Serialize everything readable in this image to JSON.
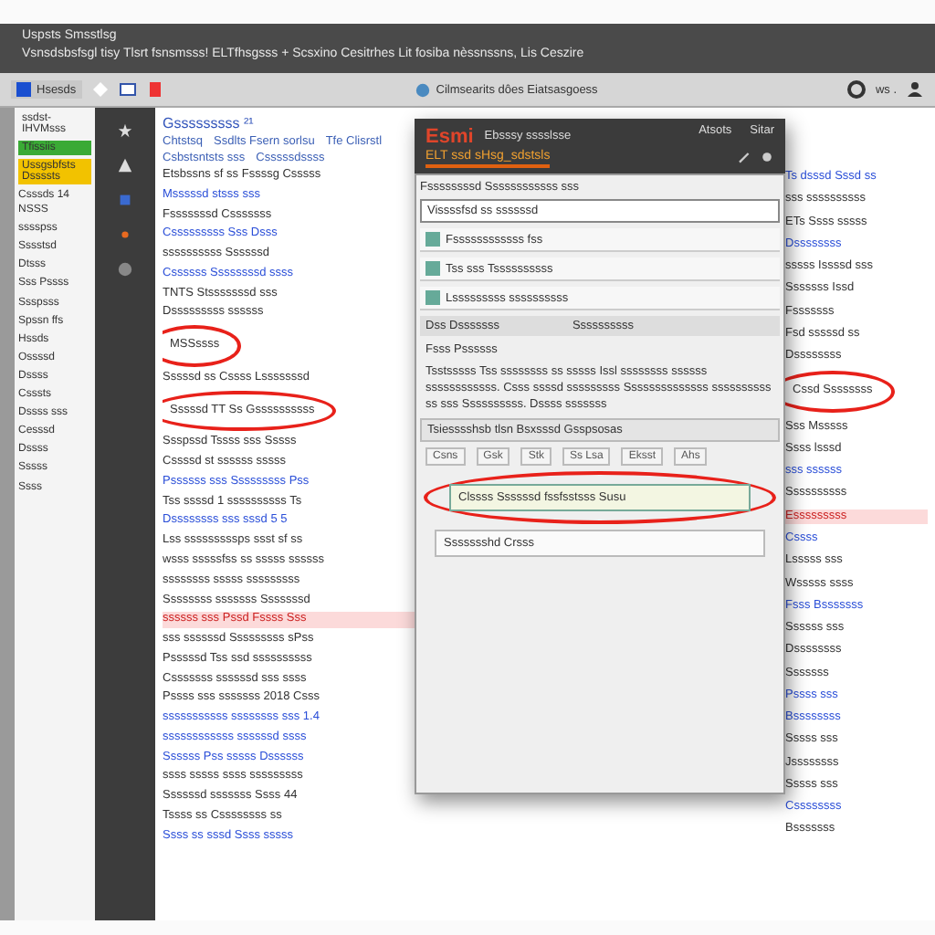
{
  "window": {
    "caption": "Uspsts Smsstlsg",
    "title": "Vsnsdsbsfsgl tisy Tlsrt fsnsmsss! ELTfhsgsss +  Scsxino Cesitrhes Lit fosiba nèssnssns, Lis Ceszire"
  },
  "toolbar": {
    "app_label": "Hsesds",
    "address": "Cilmsearits dôes Eiatsasgoess",
    "menu_label": "ws ."
  },
  "sidebar": {
    "header": "ssdst- IHVMsss",
    "items": [
      {
        "label": "Tfissiis",
        "color": "#3aaa35"
      },
      {
        "label": "Ussgsbfsts Dssssts",
        "color": "#f2c200"
      }
    ],
    "lines": [
      "Csssds 14 NSSS",
      "sssspss",
      "Sssstsd",
      "Dtsss",
      "Sss Pssss",
      "Ssspsss",
      "Spssn ffs",
      "Hssds",
      "Ossssd",
      "Dssss",
      "Csssts",
      "Dssss sss",
      "Cesssd",
      "Dssss",
      "Sssss",
      "Ssss"
    ]
  },
  "page": {
    "logo": "Gsssssssss ²¹",
    "nav": [
      "Chtstsq",
      "Ssdlts Fsern sorlsu",
      "Tfe Clisrstl"
    ],
    "subnav": [
      "Csbstsntsts sss",
      "Csssssdssss"
    ],
    "lines": [
      {
        "text": "Etsbssns sf ss Fssssg Csssss",
        "kind": "plain"
      },
      {
        "text": "Msssssd stsss sss",
        "kind": "link"
      },
      {
        "text": "Fsssssssd Csssssss",
        "kind": "plain"
      },
      {
        "text": "Csssssssss Sss Dsss",
        "kind": "link"
      },
      {
        "text": "ssssssssss Ssssssd",
        "kind": "plain"
      },
      {
        "text": "Cssssss Ssssssssd ssss",
        "kind": "link"
      },
      {
        "text": "TNTS Stsssssssd sss",
        "kind": "plain"
      },
      {
        "text": "Dsssssssss ssssss",
        "kind": "plain"
      },
      {
        "text": "MSSssss",
        "kind": "circled"
      },
      {
        "text": "Sssssd ss Cssss Lsssssssd",
        "kind": "plain"
      },
      {
        "text": "Sssssd TT Ss Gssssssssss",
        "kind": "circled"
      },
      {
        "text": "Ssspssd Tssss sss Sssss",
        "kind": "plain"
      },
      {
        "text": "Cssssd st ssssss sssss",
        "kind": "plain"
      },
      {
        "text": "Pssssss sss Sssssssss Pss",
        "kind": "link"
      },
      {
        "text": "Tss ssssd 1 ssssssssss Ts",
        "kind": "plain"
      },
      {
        "text": "Dssssssss sss sssd 5 5",
        "kind": "link"
      },
      {
        "text": "Lss sssssssssps ssst sf ss",
        "kind": "plain"
      },
      {
        "text": "wsss sssssfss ss sssss ssssss",
        "kind": "plain"
      },
      {
        "text": "ssssssss sssss sssssssss",
        "kind": "plain"
      },
      {
        "text": "Ssssssss sssssss Sssssssd",
        "kind": "plain"
      },
      {
        "text": "ssssss sss Pssd Fssss Sss",
        "kind": "highlight"
      },
      {
        "text": "sss ssssssd Sssssssss sPss",
        "kind": "plain"
      },
      {
        "text": "Psssssd Tss ssd ssssssssss",
        "kind": "plain"
      },
      {
        "text": "Csssssss ssssssd sss ssss",
        "kind": "plain"
      },
      {
        "text": "Pssss sss sssssss 2018 Csss",
        "kind": "plain"
      },
      {
        "text": "sssssssssss ssssssss sss 1.4",
        "kind": "link"
      },
      {
        "text": "ssssssssssss ssssssd ssss",
        "kind": "link"
      },
      {
        "text": "Ssssss Pss sssss Dssssss",
        "kind": "link"
      },
      {
        "text": "ssss sssss ssss sssssssss",
        "kind": "plain"
      },
      {
        "text": "Ssssssd sssssss Ssss 44",
        "kind": "plain"
      },
      {
        "text": "Tssss ss Cssssssss ss",
        "kind": "plain"
      },
      {
        "text": "Ssss ss sssd Ssss sssss",
        "kind": "link"
      }
    ]
  },
  "dialog": {
    "title": "Esmi",
    "subtitle": "Ebsssy sssslsse",
    "menu": [
      "Atsots",
      "Sitar"
    ],
    "tab": "ELT ssd sHsg_sdstsls",
    "header": "Fssssssssd Ssssssssssss sss",
    "field": "Vissssfsd ss ssssssd",
    "rows": [
      {
        "label": "Fssssssssssss fss",
        "selected": false
      },
      {
        "label": "Tss sss Tssssssssss",
        "selected": false
      },
      {
        "label": "Lsssssssss ssssssssss",
        "selected": false
      }
    ],
    "section": [
      "Dss Dsssssss",
      "Ssssssssss"
    ],
    "note": "Fsss Pssssss",
    "paragraph": "Tsstsssss Tss ssssssss ss sssss Issl ssssssss ssssss ssssssssssss. Csss ssssd sssssssss Ssssssssssssss ssssssssss ss sss Ssssssssss. Dssss sssssss",
    "bar": "Tsiesssshsb tlsn Bsxsssd Gsspsosas",
    "buttons": [
      "Csns",
      "Gsk",
      "Stk",
      "Ss Lsa",
      "Eksst",
      "Ahs"
    ],
    "items": [
      {
        "label": "Clssss Ssssssd fssfsstsss Susu",
        "selected": true,
        "circled": true
      },
      {
        "label": "Ssssssshd Crsss",
        "selected": false,
        "circled": false
      }
    ]
  },
  "right": {
    "lines": [
      {
        "text": "Ts dsssd Sssd ss",
        "kind": "link"
      },
      {
        "text": "sss ssssssssss",
        "kind": "plain"
      },
      {
        "text": "ETs Ssss sssss",
        "kind": "plain"
      },
      {
        "text": "Dssssssss",
        "kind": "link"
      },
      {
        "text": "sssss Issssd sss",
        "kind": "plain"
      },
      {
        "text": "Sssssss Issd",
        "kind": "plain"
      },
      {
        "text": "Fsssssss",
        "kind": "plain"
      },
      {
        "text": "Fsd sssssd ss",
        "kind": "plain"
      },
      {
        "text": "Dssssssss",
        "kind": "plain"
      },
      {
        "text": "Cssd Ssssssss",
        "kind": "circled"
      },
      {
        "text": "Sss Msssss",
        "kind": "plain"
      },
      {
        "text": "Ssss lsssd",
        "kind": "plain"
      },
      {
        "text": "sss ssssss",
        "kind": "link"
      },
      {
        "text": "Ssssssssss",
        "kind": "plain"
      },
      {
        "text": "Esssssssss",
        "kind": "highlight"
      },
      {
        "text": "Cssss",
        "kind": "link"
      },
      {
        "text": "Lsssss sss",
        "kind": "plain"
      },
      {
        "text": "Wsssss ssss",
        "kind": "plain"
      },
      {
        "text": "Fsss Bsssssss",
        "kind": "link"
      },
      {
        "text": "Ssssss sss",
        "kind": "plain"
      },
      {
        "text": "Dssssssss",
        "kind": "plain"
      },
      {
        "text": "Sssssss",
        "kind": "plain"
      },
      {
        "text": "Pssss sss",
        "kind": "link"
      },
      {
        "text": "Bssssssss",
        "kind": "link"
      },
      {
        "text": "Sssss sss",
        "kind": "plain"
      },
      {
        "text": "Jssssssss",
        "kind": "plain"
      },
      {
        "text": "Sssss sss",
        "kind": "plain"
      },
      {
        "text": "Cssssssss",
        "kind": "link"
      },
      {
        "text": "Bsssssss",
        "kind": "plain"
      }
    ]
  }
}
